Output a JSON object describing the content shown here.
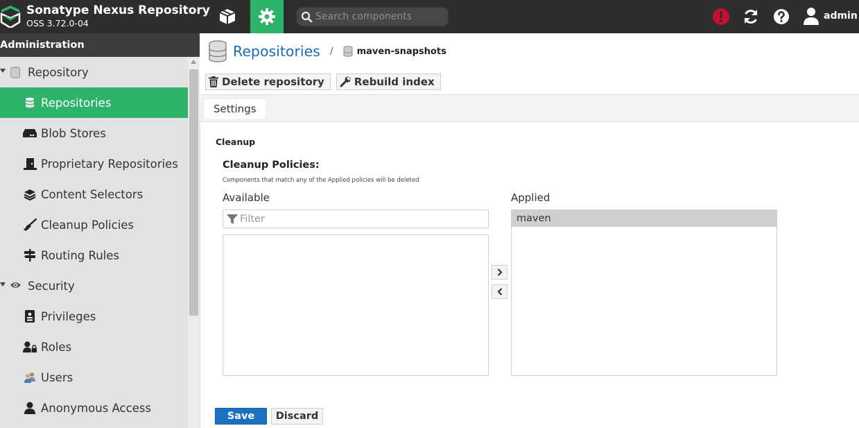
{
  "header": {
    "app_name": "Sonatype Nexus Repository",
    "version": "OSS 3.72.0-04",
    "search_placeholder": "Search components",
    "user_name": "admin",
    "colors": {
      "bar": "#2e2e2e",
      "active_mode": "#2eb36b",
      "alert": "#d0021b"
    },
    "icons": [
      "nexus-logo-icon",
      "cube-icon",
      "gear-icon",
      "search-icon",
      "alert-icon",
      "refresh-icon",
      "help-icon",
      "user-icon"
    ]
  },
  "sidebar": {
    "title": "Administration",
    "groups": [
      {
        "label": "Repository",
        "icon": "database-icon",
        "items": [
          {
            "label": "Repositories",
            "icon": "database-icon",
            "selected": true
          },
          {
            "label": "Blob Stores",
            "icon": "hard-drive-icon"
          },
          {
            "label": "Proprietary Repositories",
            "icon": "door-icon"
          },
          {
            "label": "Content Selectors",
            "icon": "layers-icon"
          },
          {
            "label": "Cleanup Policies",
            "icon": "broom-icon"
          },
          {
            "label": "Routing Rules",
            "icon": "signpost-icon"
          }
        ]
      },
      {
        "label": "Security",
        "icon": "eye-icon",
        "items": [
          {
            "label": "Privileges",
            "icon": "id-badge-icon"
          },
          {
            "label": "Roles",
            "icon": "user-lock-icon"
          },
          {
            "label": "Users",
            "icon": "users-icon"
          },
          {
            "label": "Anonymous Access",
            "icon": "user-icon"
          }
        ]
      }
    ]
  },
  "main": {
    "breadcrumb": {
      "title": "Repositories",
      "separator": "/",
      "current": "maven-snapshots"
    },
    "toolbar": {
      "delete_label": "Delete repository",
      "rebuild_label": "Rebuild index"
    },
    "tabs": [
      {
        "label": "Settings",
        "active": true
      }
    ],
    "section": "Cleanup",
    "field": {
      "label": "Cleanup Policies:",
      "help": "Components that match any of the Applied policies will be deleted",
      "available_label": "Available",
      "applied_label": "Applied",
      "filter_placeholder": "Filter",
      "available_items": [],
      "applied_items": [
        "maven"
      ]
    },
    "buttons": {
      "save": "Save",
      "discard": "Discard"
    }
  }
}
